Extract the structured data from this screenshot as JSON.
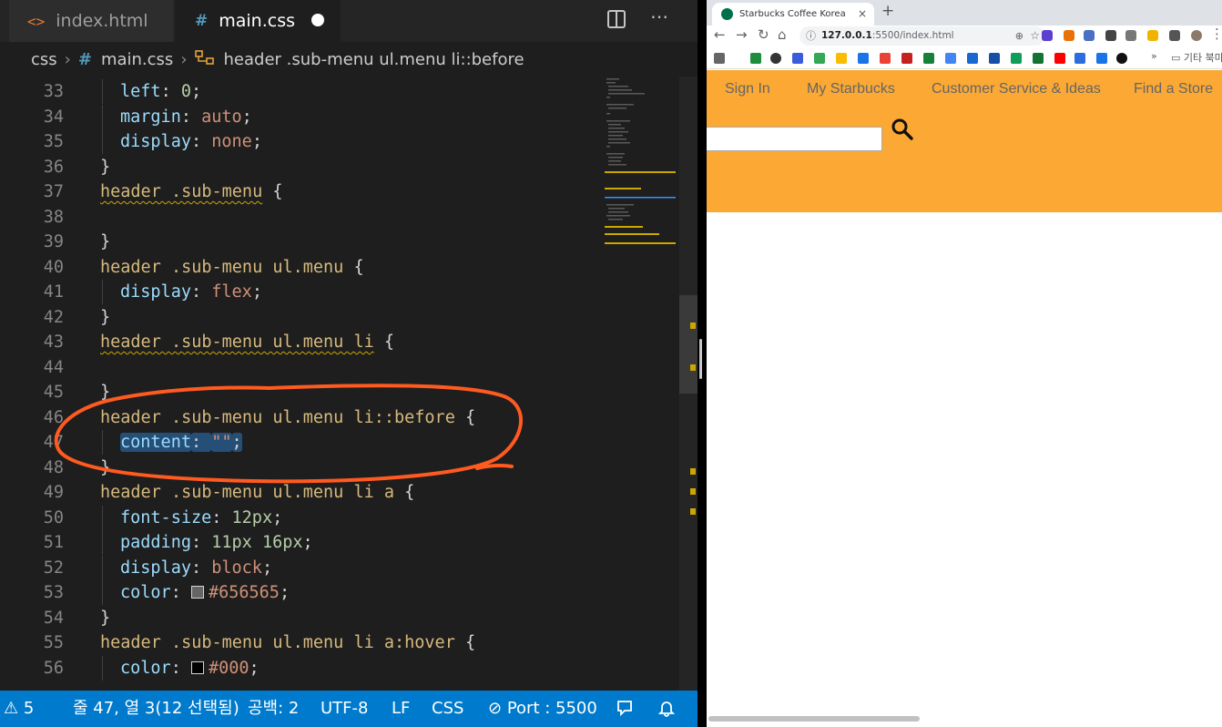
{
  "editor": {
    "tabs": [
      {
        "label": "index.html",
        "icon": "html-file-icon",
        "active": false
      },
      {
        "label": "main.css",
        "icon": "css-file-icon",
        "active": true,
        "dirty": true
      }
    ],
    "breadcrumb": {
      "folder": "css",
      "file": "main.css",
      "selector": "header .sub-menu ul.menu li::before"
    },
    "lines": [
      {
        "n": "33",
        "segs": [
          [
            "prop",
            "left"
          ],
          [
            "punc",
            ": "
          ],
          [
            "num",
            "0"
          ],
          [
            "punc",
            ";"
          ]
        ],
        "indent": true
      },
      {
        "n": "34",
        "segs": [
          [
            "prop",
            "margin"
          ],
          [
            "punc",
            ": "
          ],
          [
            "val",
            "auto"
          ],
          [
            "punc",
            ";"
          ]
        ],
        "indent": true
      },
      {
        "n": "35",
        "segs": [
          [
            "prop",
            "display"
          ],
          [
            "punc",
            ": "
          ],
          [
            "val",
            "none"
          ],
          [
            "punc",
            ";"
          ]
        ],
        "indent": true
      },
      {
        "n": "36",
        "segs": [
          [
            "punc",
            "}"
          ]
        ],
        "indent": false
      },
      {
        "n": "37",
        "segs": [
          [
            "sel squig",
            "header .sub-menu"
          ],
          [
            "punc",
            " {"
          ]
        ],
        "indent": false
      },
      {
        "n": "38",
        "segs": [],
        "indent": false
      },
      {
        "n": "39",
        "segs": [
          [
            "punc",
            "}"
          ]
        ],
        "indent": false
      },
      {
        "n": "40",
        "segs": [
          [
            "sel",
            "header .sub-menu ul.menu"
          ],
          [
            "punc",
            " {"
          ]
        ],
        "indent": false
      },
      {
        "n": "41",
        "segs": [
          [
            "prop",
            "display"
          ],
          [
            "punc",
            ": "
          ],
          [
            "val",
            "flex"
          ],
          [
            "punc",
            ";"
          ]
        ],
        "indent": true
      },
      {
        "n": "42",
        "segs": [
          [
            "punc",
            "}"
          ]
        ],
        "indent": false
      },
      {
        "n": "43",
        "segs": [
          [
            "sel squig",
            "header .sub-menu ul.menu li"
          ],
          [
            "punc",
            " {"
          ]
        ],
        "indent": false
      },
      {
        "n": "44",
        "segs": [],
        "indent": false
      },
      {
        "n": "45",
        "segs": [
          [
            "punc",
            "}"
          ]
        ],
        "indent": false
      },
      {
        "n": "46",
        "segs": [
          [
            "sel",
            "header .sub-menu ul.menu li::before"
          ],
          [
            "punc",
            " {"
          ]
        ],
        "indent": false
      },
      {
        "n": "47",
        "segs": [
          [
            "prop selected-bg",
            "content"
          ],
          [
            "punc selected-bg",
            ": "
          ],
          [
            "val selected-bg",
            "\"\""
          ],
          [
            "punc selected-bg",
            ";"
          ]
        ],
        "indent": true
      },
      {
        "n": "48",
        "segs": [
          [
            "punc",
            "}"
          ]
        ],
        "indent": false
      },
      {
        "n": "49",
        "segs": [
          [
            "sel",
            "header .sub-menu ul.menu li a"
          ],
          [
            "punc",
            " {"
          ]
        ],
        "indent": false
      },
      {
        "n": "50",
        "segs": [
          [
            "prop",
            "font-size"
          ],
          [
            "punc",
            ": "
          ],
          [
            "num",
            "12px"
          ],
          [
            "punc",
            ";"
          ]
        ],
        "indent": true
      },
      {
        "n": "51",
        "segs": [
          [
            "prop",
            "padding"
          ],
          [
            "punc",
            ": "
          ],
          [
            "num",
            "11px 16px"
          ],
          [
            "punc",
            ";"
          ]
        ],
        "indent": true
      },
      {
        "n": "52",
        "segs": [
          [
            "prop",
            "display"
          ],
          [
            "punc",
            ": "
          ],
          [
            "val",
            "block"
          ],
          [
            "punc",
            ";"
          ]
        ],
        "indent": true
      },
      {
        "n": "53",
        "segs": [
          [
            "prop",
            "color"
          ],
          [
            "punc",
            ": "
          ],
          [
            "swatch",
            "#656565"
          ],
          [
            "val",
            "#656565"
          ],
          [
            "punc",
            ";"
          ]
        ],
        "indent": true
      },
      {
        "n": "54",
        "segs": [
          [
            "punc",
            "}"
          ]
        ],
        "indent": false
      },
      {
        "n": "55",
        "segs": [
          [
            "sel",
            "header .sub-menu ul.menu li a:hover"
          ],
          [
            "punc",
            " {"
          ]
        ],
        "indent": false
      },
      {
        "n": "56",
        "segs": [
          [
            "prop",
            "color"
          ],
          [
            "punc",
            ": "
          ],
          [
            "swatch",
            "#000"
          ],
          [
            "val",
            "#000"
          ],
          [
            "punc",
            ";"
          ]
        ],
        "indent": true
      }
    ],
    "annotation_color": "#ff5a1f",
    "status": {
      "warnings": "5",
      "position": "줄 47, 열 3(12 선택됨)",
      "spaces": "공백: 2",
      "encoding": "UTF-8",
      "eol": "LF",
      "language": "CSS",
      "port": "Port : 5500"
    }
  },
  "browser": {
    "tab_title": "Starbucks Coffee Korea",
    "url_host": "127.0.0.1",
    "url_rest": ":5500/index.html",
    "bookmarks_more": "기타 북마크",
    "page": {
      "header_bg": "#fba834",
      "submenu": [
        "Sign In",
        "My Starbucks",
        "Customer Service & Ideas",
        "Find a Store"
      ],
      "search_value": ""
    }
  }
}
